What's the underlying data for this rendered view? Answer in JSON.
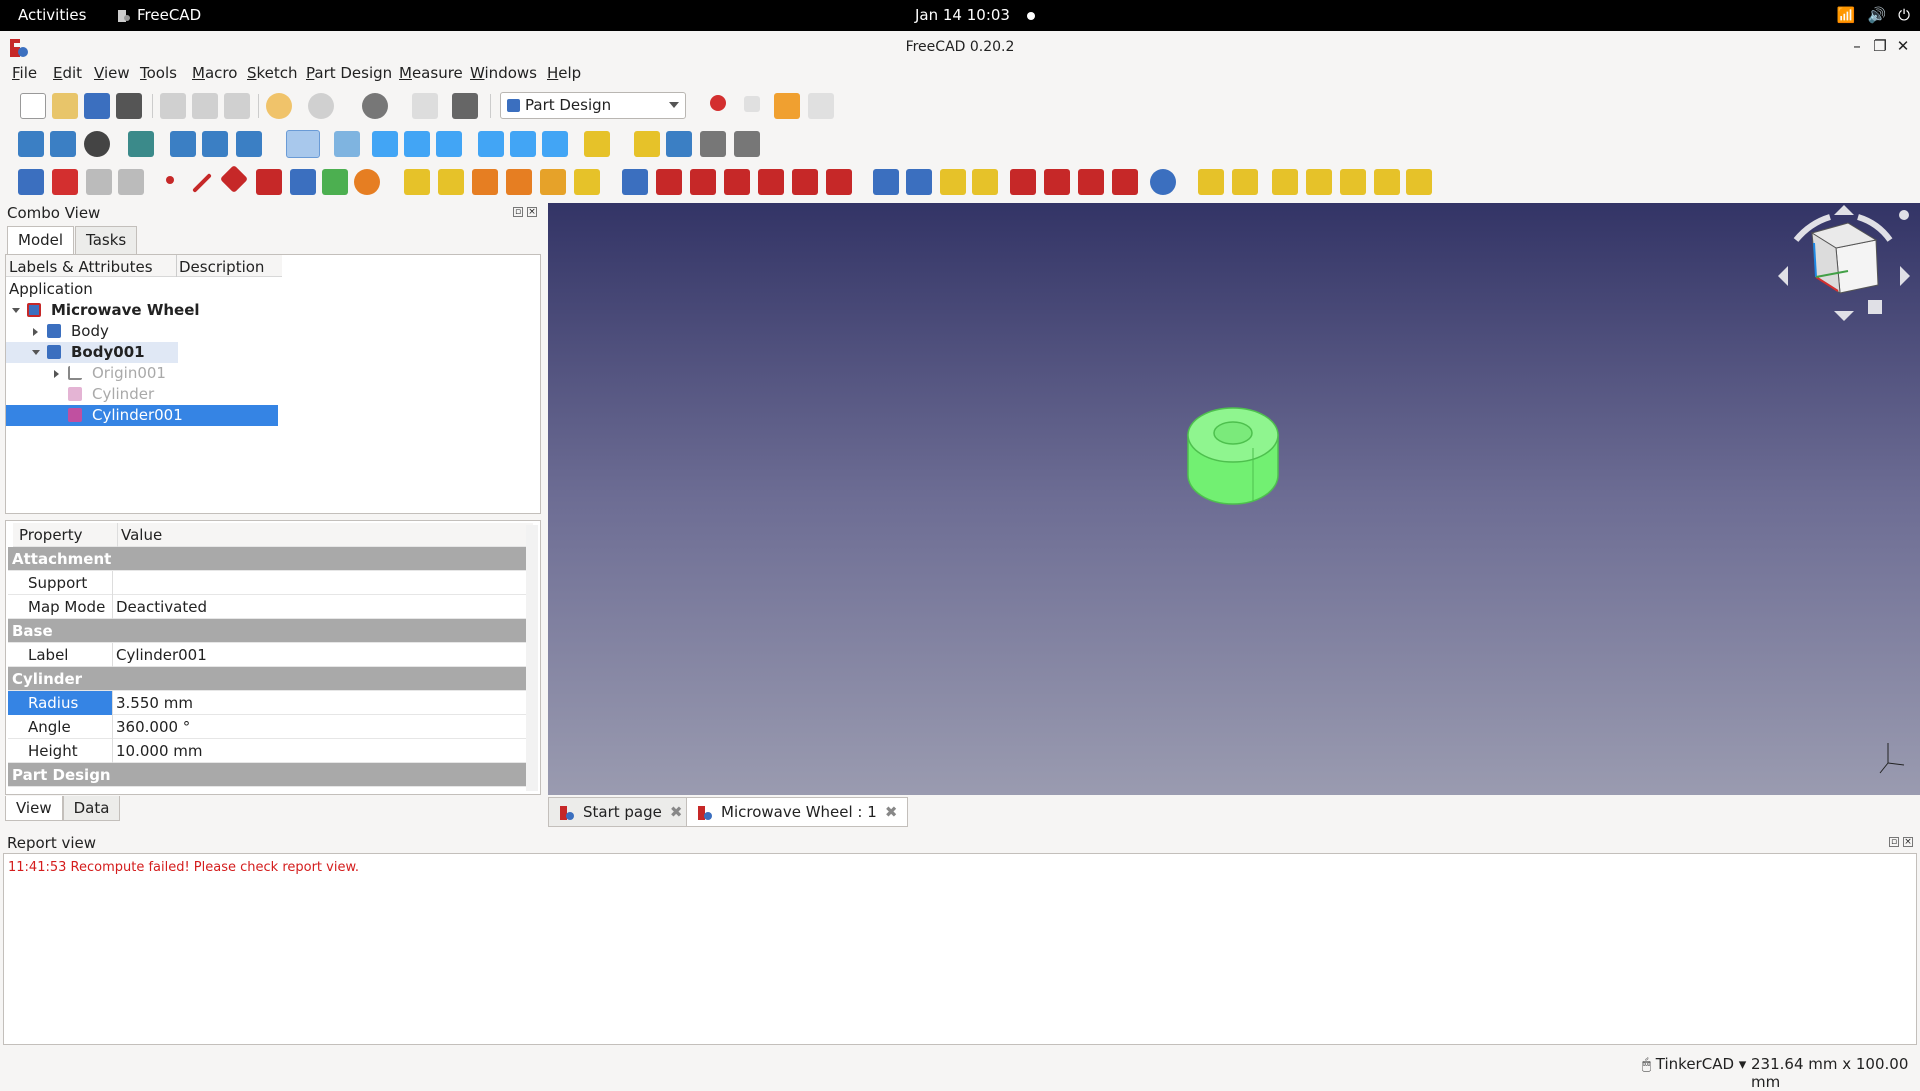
{
  "topbar": {
    "activities": "Activities",
    "app_name": "FreeCAD",
    "clock": "Jan 14  10:03"
  },
  "window": {
    "title": "FreeCAD 0.20.2"
  },
  "menu": {
    "items": [
      "File",
      "Edit",
      "View",
      "Tools",
      "Macro",
      "Sketch",
      "Part Design",
      "Measure",
      "Windows",
      "Help"
    ]
  },
  "toolbar": {
    "workbench": "Part Design"
  },
  "combo": {
    "title": "Combo View",
    "tabs": [
      "Model",
      "Tasks"
    ],
    "tree_headers": [
      "Labels & Attributes",
      "Description"
    ],
    "tree": {
      "root": "Application",
      "doc": "Microwave Wheel",
      "items": [
        "Body",
        "Body001",
        "Origin001",
        "Cylinder",
        "Cylinder001"
      ]
    },
    "props_headers": [
      "Property",
      "Value"
    ],
    "groups": {
      "attachment": "Attachment",
      "base": "Base",
      "cylinder": "Cylinder",
      "part_design": "Part Design"
    },
    "props": {
      "support": {
        "name": "Support",
        "value": ""
      },
      "map_mode": {
        "name": "Map Mode",
        "value": "Deactivated"
      },
      "label": {
        "name": "Label",
        "value": "Cylinder001"
      },
      "radius": {
        "name": "Radius",
        "value": "3.550 mm"
      },
      "angle": {
        "name": "Angle",
        "value": "360.000 °"
      },
      "height": {
        "name": "Height",
        "value": "10.000 mm"
      }
    },
    "bottom_tabs": [
      "View",
      "Data"
    ]
  },
  "doc_tabs": [
    "Start page",
    "Microwave Wheel : 1"
  ],
  "report": {
    "title": "Report view",
    "message": "11:41:53  Recompute failed! Please check report view."
  },
  "status": {
    "nav_style": "TinkerCAD",
    "dimensions": "231.64 mm x 100.00 mm"
  },
  "colors": {
    "selection": "#3584e4",
    "model": "#7cf57c",
    "error_text": "#d41d1d"
  }
}
